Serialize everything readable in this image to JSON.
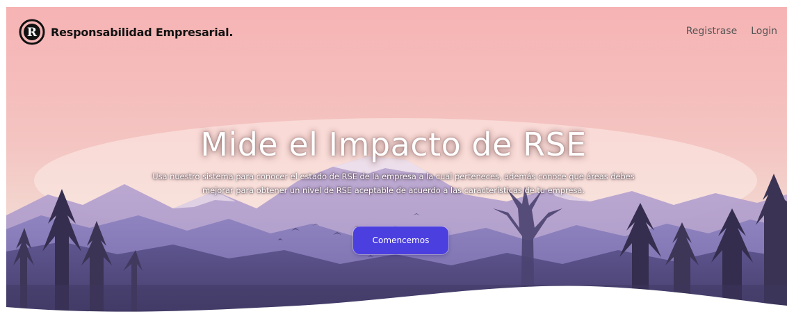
{
  "brand": {
    "logo_letter": "R",
    "name": "Responsabilidad Empresarial."
  },
  "nav": {
    "register_label": "Registrase",
    "login_label": "Login"
  },
  "hero": {
    "title": "Mide el Impacto de RSE",
    "description": "Usa nuestro sistema para conocer el estado de RSE de la empresa a la cual perteneces, además conoce que áreas debes mejorar para obtener un nivel de RSE aceptable de acuerdo a las características de tu empresa.",
    "cta_label": "Comencemos"
  },
  "colors": {
    "sky_top": "#f4b7b7",
    "sky_bottom": "#f3d9d3",
    "accent": "#4b3fe0",
    "forest_dark": "#3b3350"
  },
  "icons": {
    "logo": "r-circle-logo-icon"
  }
}
